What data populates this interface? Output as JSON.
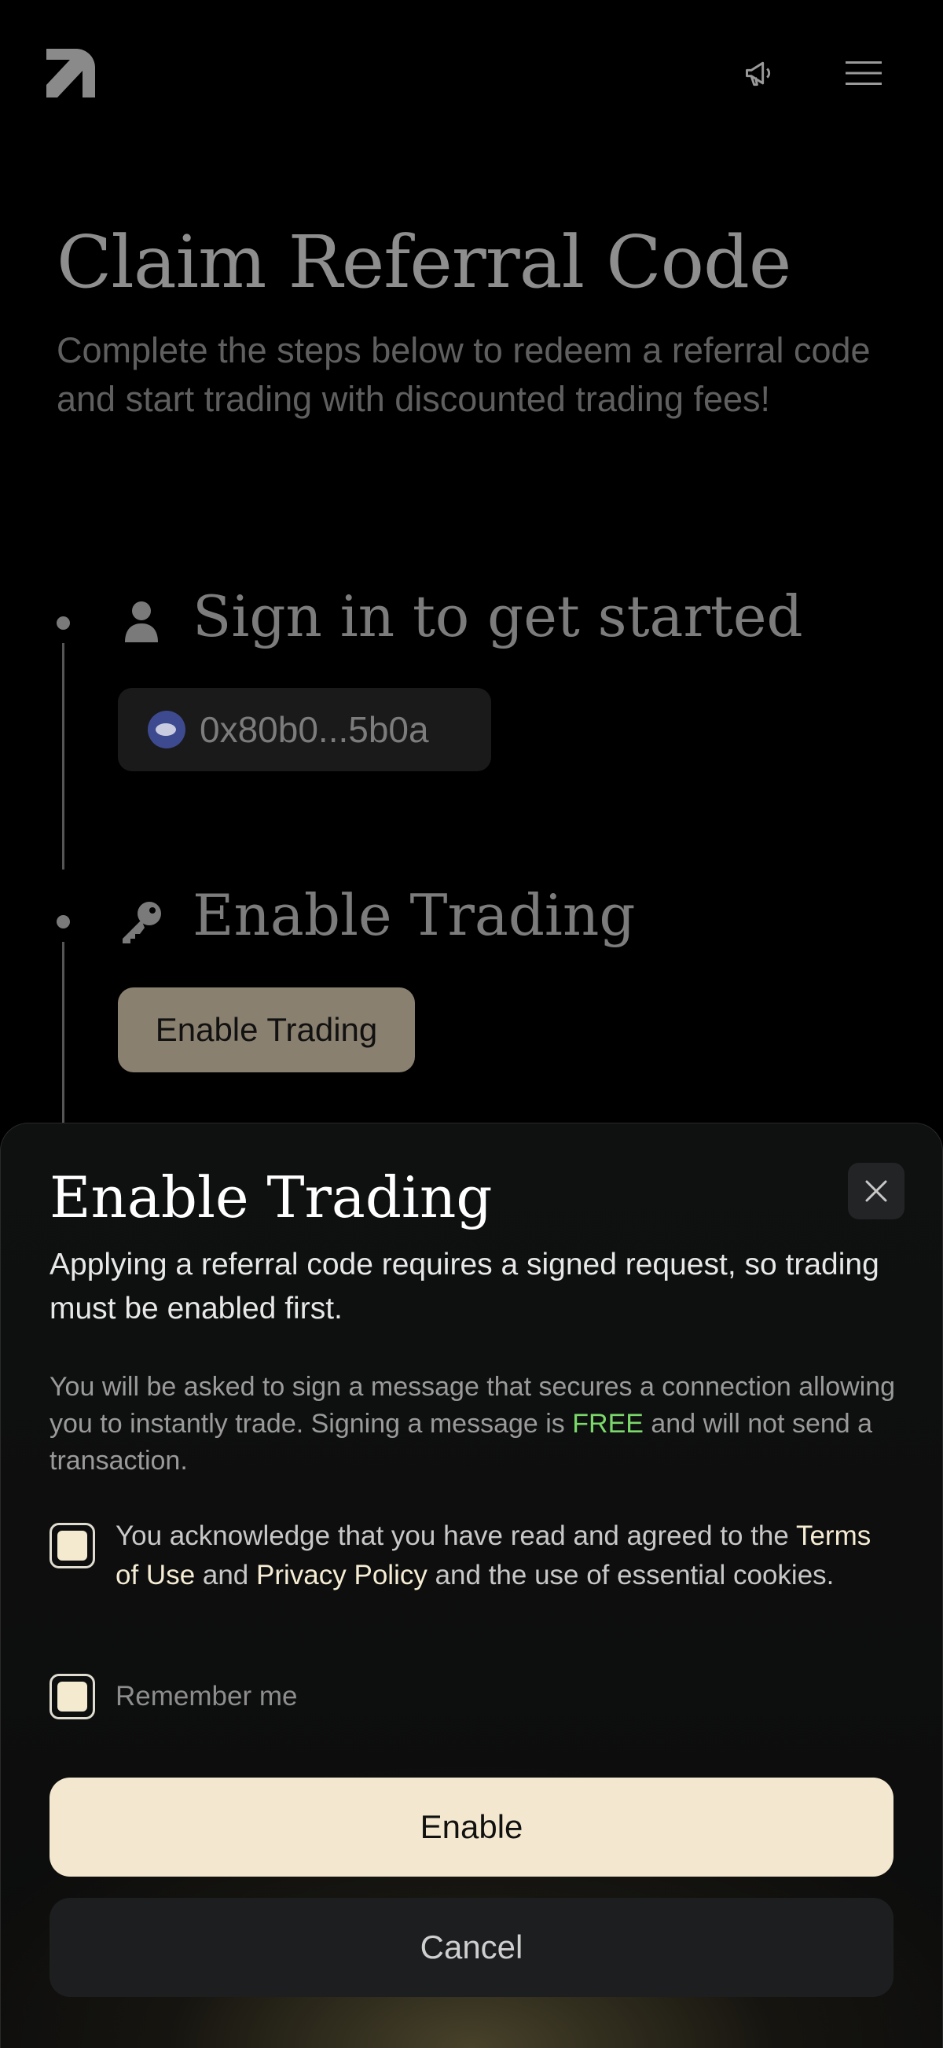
{
  "header": {
    "logo_icon": "app-logo-icon",
    "announcements_icon": "megaphone-icon",
    "menu_icon": "hamburger-menu-icon"
  },
  "page": {
    "title": "Claim Referral Code",
    "subtitle": "Complete the steps below to redeem a referral code and start trading with discounted trading fees!"
  },
  "steps": [
    {
      "icon": "user-icon",
      "title": "Sign in to get started",
      "wallet_address": "0x80b0...5b0a"
    },
    {
      "icon": "key-icon",
      "title": "Enable Trading",
      "button_label": "Enable Trading"
    }
  ],
  "modal": {
    "title": "Enable Trading",
    "lead": "Applying a referral code requires a signed request, so trading must be enabled first.",
    "body_before": "You will be asked to sign a message that secures a connection allowing you to instantly trade. Signing a message is ",
    "body_free": "FREE",
    "body_after": " and will not send a transaction.",
    "terms_prefix": "You acknowledge that you have read and agreed to the ",
    "terms_link": "Terms of Use",
    "terms_and": " and ",
    "privacy_link": "Privacy Policy",
    "terms_suffix": " and the use of essential cookies.",
    "remember_label": "Remember me",
    "primary_label": "Enable",
    "secondary_label": "Cancel",
    "close_icon": "close-icon"
  },
  "colors": {
    "accent": "#f3e8cf",
    "free_green": "#7bd86b",
    "background": "#000000"
  }
}
